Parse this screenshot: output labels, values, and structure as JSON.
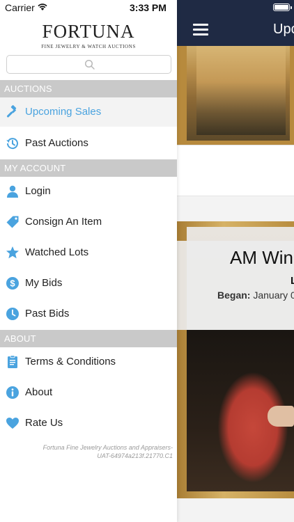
{
  "status_bar": {
    "carrier": "Carrier",
    "time": "3:33 PM"
  },
  "background": {
    "title_fragment": "Upco",
    "card_title_fragment": "AM Win",
    "card_line_fragment": "L",
    "began_label": "Began:",
    "began_value_fragment": "January 0"
  },
  "drawer": {
    "logo_main": "FORTUNA",
    "logo_sub": "FINE JEWELRY & WATCH AUCTIONS",
    "search": {
      "value": "",
      "icon": "search-icon"
    },
    "sections": [
      {
        "title": "AUCTIONS",
        "items": [
          {
            "label": "Upcoming Sales",
            "icon": "gavel-icon",
            "active": true
          },
          {
            "label": "Past Auctions",
            "icon": "history-icon",
            "active": false
          }
        ]
      },
      {
        "title": "MY ACCOUNT",
        "items": [
          {
            "label": "Login",
            "icon": "user-icon",
            "active": false
          },
          {
            "label": "Consign An Item",
            "icon": "tag-icon",
            "active": false
          },
          {
            "label": "Watched Lots",
            "icon": "star-icon",
            "active": false
          },
          {
            "label": "My Bids",
            "icon": "dollar-icon",
            "active": false
          },
          {
            "label": "Past Bids",
            "icon": "clock-icon",
            "active": false
          }
        ]
      },
      {
        "title": "ABOUT",
        "items": [
          {
            "label": "Terms & Conditions",
            "icon": "document-icon",
            "active": false
          },
          {
            "label": "About",
            "icon": "info-icon",
            "active": false
          },
          {
            "label": "Rate Us",
            "icon": "heart-icon",
            "active": false
          }
        ]
      }
    ],
    "footer": {
      "line1": "Fortuna Fine Jewelry Auctions and Appraisers-",
      "line2": "UAT-64974a213f.21770.C1"
    }
  },
  "colors": {
    "accent": "#4aa3df",
    "icon_blue": "#4aa3df",
    "section_bg": "#c9c9c9",
    "topbar_bg": "#1f2a44"
  }
}
